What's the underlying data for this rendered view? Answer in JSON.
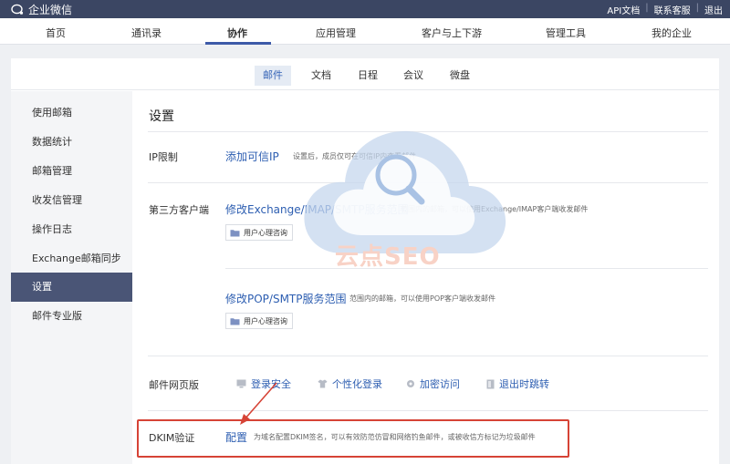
{
  "app": {
    "logo_text": "企业微信"
  },
  "top_links": [
    "API文档",
    "联系客服",
    "退出"
  ],
  "main_nav": [
    {
      "label": "首页"
    },
    {
      "label": "通讯录"
    },
    {
      "label": "协作",
      "active": true
    },
    {
      "label": "应用管理"
    },
    {
      "label": "客户与上下游"
    },
    {
      "label": "管理工具"
    },
    {
      "label": "我的企业"
    }
  ],
  "sub_tabs": [
    {
      "label": "邮件",
      "active": true
    },
    {
      "label": "文档"
    },
    {
      "label": "日程"
    },
    {
      "label": "会议"
    },
    {
      "label": "微盘"
    }
  ],
  "sidebar": [
    {
      "label": "使用邮箱"
    },
    {
      "label": "数据统计"
    },
    {
      "label": "邮箱管理"
    },
    {
      "label": "收发信管理"
    },
    {
      "label": "操作日志"
    },
    {
      "label": "Exchange邮箱同步"
    },
    {
      "label": "设置",
      "active": true
    },
    {
      "label": "邮件专业版"
    }
  ],
  "settings": {
    "title": "设置",
    "ip": {
      "label": "IP限制",
      "link": "添加可信IP",
      "desc": "设置后，成员仅可在可信IP内查看邮件"
    },
    "third_party": {
      "label": "第三方客户端",
      "exchange_link": "修改Exchange/IMAP/SMTP服务范围",
      "exchange_desc": "范围内的邮箱，可以使用Exchange/IMAP客户端收发邮件",
      "exchange_chip": "用户心理咨询",
      "pop_link": "修改POP/SMTP服务范围",
      "pop_desc": "范围内的邮箱，可以使用POP客户端收发邮件",
      "pop_chip": "用户心理咨询"
    },
    "web": {
      "label": "邮件网页版",
      "options": [
        {
          "label": "登录安全",
          "icon": "monitor-icon"
        },
        {
          "label": "个性化登录",
          "icon": "shirt-icon"
        },
        {
          "label": "加密访问",
          "icon": "gear-icon"
        },
        {
          "label": "退出时跳转",
          "icon": "exit-icon"
        }
      ]
    },
    "dkim": {
      "label": "DKIM验证",
      "link": "配置",
      "desc": "为域名配置DKIM签名，可以有效防范仿冒和网络钓鱼邮件，或被收信方标记为垃圾邮件"
    }
  },
  "watermark": {
    "text": "云点SEO"
  },
  "colors": {
    "topbar": "#3b4663",
    "link": "#2d5eb1",
    "sidebar_active": "#4a5576",
    "highlight": "#d64336",
    "watermark": "#c5d7ee"
  }
}
